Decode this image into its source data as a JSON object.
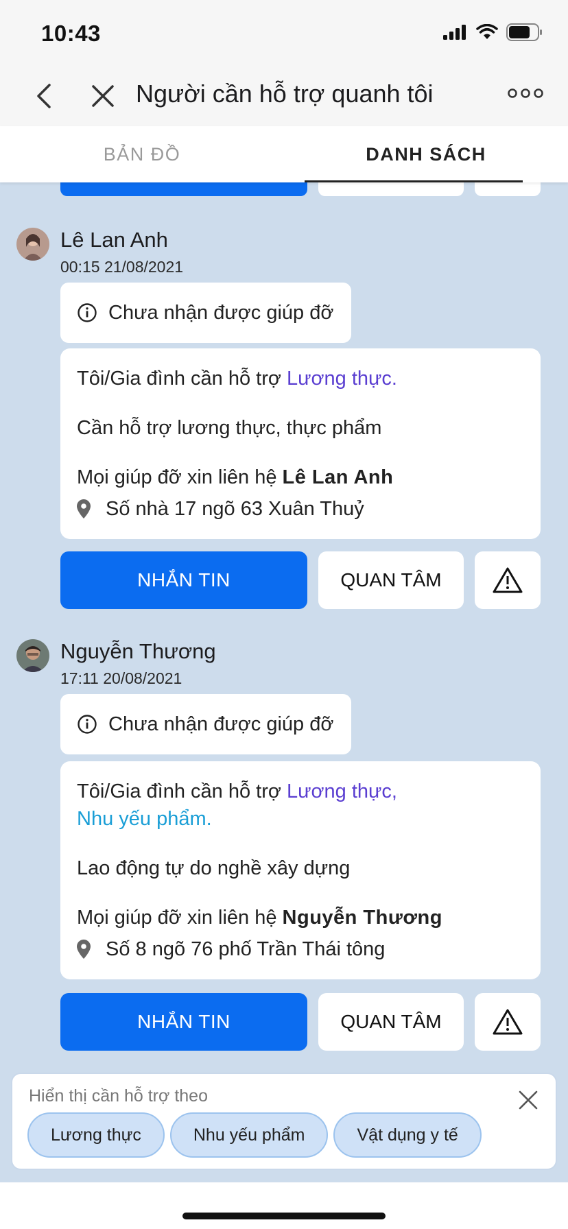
{
  "status_bar": {
    "time": "10:43"
  },
  "nav": {
    "title": "Người cần hỗ trợ quanh tôi"
  },
  "tabs": [
    {
      "label": "BẢN ĐỒ",
      "active": false
    },
    {
      "label": "DANH SÁCH",
      "active": true
    }
  ],
  "posts": [
    {
      "name": "Lê Lan Anh",
      "time": "00:15 21/08/2021",
      "status": "Chưa nhận được giúp đỡ",
      "need_prefix": "Tôi/Gia đình cần hỗ trợ",
      "need_tags": [
        "Lương thực."
      ],
      "description": "Cần hỗ trợ lương thực, thực phẩm",
      "contact_prefix": "Mọi giúp đỡ xin liên hệ",
      "contact_name": "Lê Lan Anh",
      "address": "Số nhà 17 ngõ 63 Xuân Thuỷ",
      "message_label": "NHẮN TIN",
      "care_label": "QUAN TÂM"
    },
    {
      "name": "Nguyễn Thương",
      "time": "17:11 20/08/2021",
      "status": "Chưa nhận được giúp đỡ",
      "need_prefix": "Tôi/Gia đình cần hỗ trợ",
      "need_tags": [
        "Lương thực,",
        "Nhu yếu phẩm."
      ],
      "description": "Lao động tự do nghề xây dựng",
      "contact_prefix": "Mọi giúp đỡ xin liên hệ",
      "contact_name": "Nguyễn Thương",
      "address": "Số 8 ngõ 76 phố Trần Thái tông",
      "message_label": "NHẮN TIN",
      "care_label": "QUAN TÂM"
    }
  ],
  "filter": {
    "title": "Hiển thị cần hỗ trợ theo",
    "chips": [
      "Lương thực",
      "Nhu yếu phẩm",
      "Vật dụng y tế"
    ]
  },
  "colors": {
    "primary": "#0b6cf0",
    "background": "#cddcec",
    "tag_food": "#5a3ed1",
    "tag_needs": "#1a9ed6"
  },
  "icons": [
    "back-icon",
    "close-icon",
    "more-icon",
    "info-icon",
    "location-pin-icon",
    "warning-icon"
  ]
}
